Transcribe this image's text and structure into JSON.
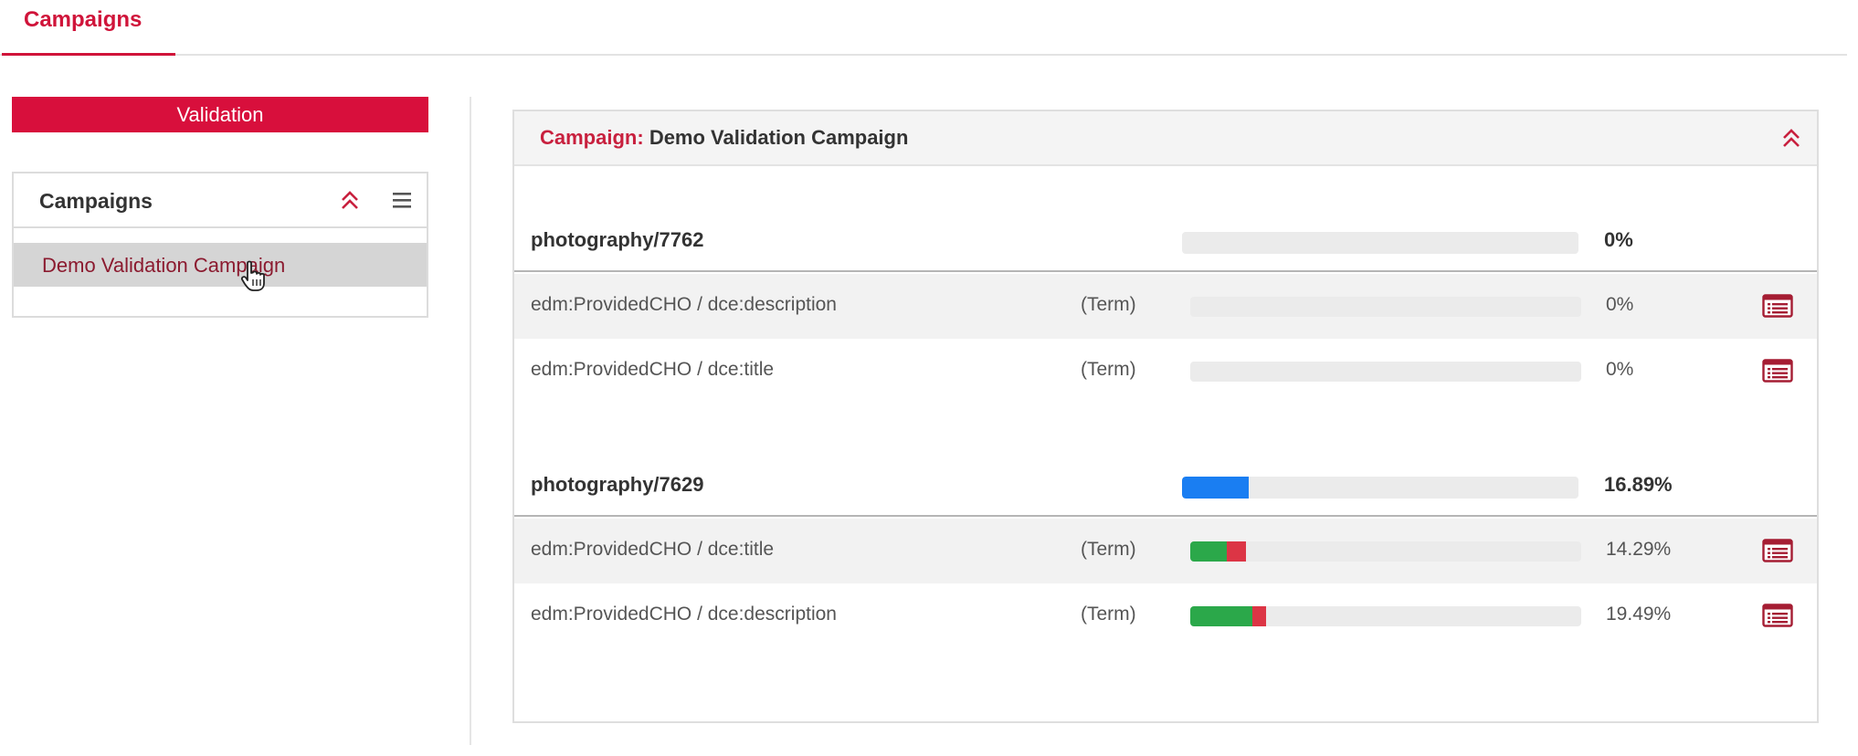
{
  "top_tabs": {
    "campaigns": "Campaigns"
  },
  "sidebar": {
    "validation_button": "Validation",
    "campaigns_panel": {
      "title": "Campaigns",
      "items": [
        "Demo Validation Campaign"
      ]
    }
  },
  "campaign_panel": {
    "label": "Campaign:",
    "name": "Demo Validation Campaign",
    "groups": [
      {
        "name": "photography/7762",
        "percent_label": "0%",
        "progress": 0,
        "fields": [
          {
            "name": "edm:ProvidedCHO / dce:description",
            "kind": "(Term)",
            "percent_label": "0%",
            "valid": 0,
            "invalid": 0
          },
          {
            "name": "edm:ProvidedCHO / dce:title",
            "kind": "(Term)",
            "percent_label": "0%",
            "valid": 0,
            "invalid": 0
          }
        ]
      },
      {
        "name": "photography/7629",
        "percent_label": "16.89%",
        "progress": 16.89,
        "fields": [
          {
            "name": "edm:ProvidedCHO / dce:title",
            "kind": "(Term)",
            "percent_label": "14.29%",
            "valid": 9.3,
            "invalid": 5.0
          },
          {
            "name": "edm:ProvidedCHO / dce:description",
            "kind": "(Term)",
            "percent_label": "19.49%",
            "valid": 15.9,
            "invalid": 3.6
          }
        ]
      }
    ]
  },
  "colors": {
    "brand": "#d80f3c",
    "progress": "#1a7ef2",
    "valid": "#2ba84a",
    "invalid": "#dc3545"
  },
  "icons": {
    "collapse": "double-chevron-up-icon",
    "menu": "hamburger-menu-icon",
    "report": "list-report-icon",
    "cursor": "hand-pointer-icon"
  }
}
